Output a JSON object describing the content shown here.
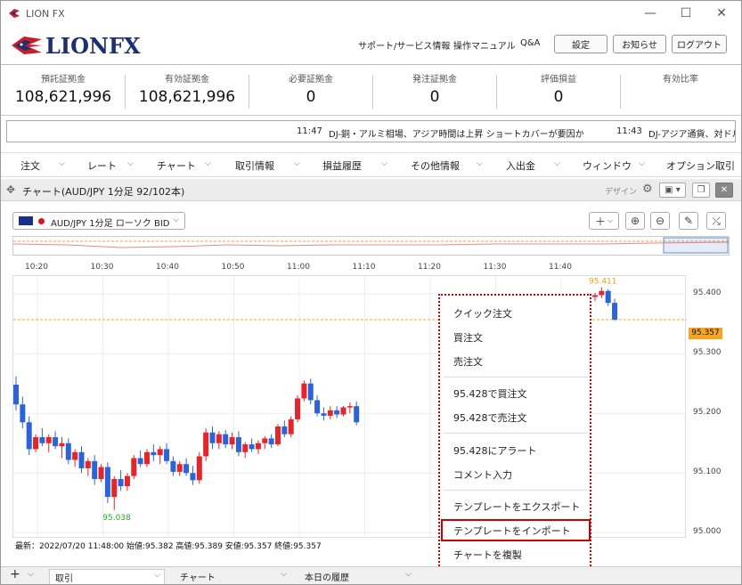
{
  "window": {
    "title": "LION FX",
    "minimize": "—",
    "maximize": "☐",
    "close": "✕"
  },
  "brand": {
    "logo_text": "LIONFX"
  },
  "header_links": [
    "サポート/サービス情報",
    "操作マニュアル",
    "Q&A"
  ],
  "header_buttons": [
    "設定",
    "お知らせ",
    "ログアウト"
  ],
  "summary": [
    {
      "label": "預託証拠金",
      "value": "108,621,996"
    },
    {
      "label": "有効証拠金",
      "value": "108,621,996"
    },
    {
      "label": "必要証拠金",
      "value": "0"
    },
    {
      "label": "発注証拠金",
      "value": "0"
    },
    {
      "label": "評価損益",
      "value": "0"
    },
    {
      "label": "有効比率",
      "value": ""
    }
  ],
  "ticker": [
    {
      "time": "11:47",
      "text": "DJ-銅・アルミ相場、アジア時間は上昇 ショートカバーが要因か"
    },
    {
      "time": "11:43",
      "text": "DJ-アジア通貨、対ドル"
    }
  ],
  "menubar": [
    "注文",
    "レート",
    "チャート",
    "取引情報",
    "損益履歴",
    "その他情報",
    "入出金",
    "ウィンドウ",
    "オプション取引"
  ],
  "chart_window": {
    "title": "チャート(AUD/JPY 1分足 92/102本)",
    "design_label": "デザイン"
  },
  "symbol_select": {
    "value": "AUD/JPY 1分足 ローソク BID"
  },
  "chart_toolbar_icons": [
    "plus-icon",
    "zoom-in-icon",
    "zoom-out-icon",
    "pen-icon",
    "trendline-icon"
  ],
  "chart_data": {
    "type": "candlestick",
    "title": "",
    "x_tick_labels": [
      "10:20",
      "10:30",
      "10:40",
      "10:50",
      "11:00",
      "11:10",
      "11:20",
      "11:30",
      "11:40"
    ],
    "y_tick_labels": [
      "95.400",
      "95.300",
      "95.200",
      "95.100",
      "95.000"
    ],
    "ylim": [
      94.99,
      95.43
    ],
    "current_price": "95.357",
    "high_label": "95.411",
    "low_label": "95.038",
    "candles": [
      [
        95.248,
        95.262,
        95.205,
        95.215
      ],
      [
        95.215,
        95.228,
        95.175,
        95.185
      ],
      [
        95.185,
        95.195,
        95.13,
        95.14
      ],
      [
        95.14,
        95.165,
        95.135,
        95.16
      ],
      [
        95.16,
        95.175,
        95.145,
        95.15
      ],
      [
        95.15,
        95.165,
        95.135,
        95.16
      ],
      [
        95.16,
        95.17,
        95.14,
        95.145
      ],
      [
        95.145,
        95.16,
        95.125,
        95.15
      ],
      [
        95.15,
        95.158,
        95.115,
        95.122
      ],
      [
        95.122,
        95.14,
        95.11,
        95.135
      ],
      [
        95.135,
        95.145,
        95.1,
        95.108
      ],
      [
        95.108,
        95.125,
        95.095,
        95.12
      ],
      [
        95.12,
        95.13,
        95.08,
        95.09
      ],
      [
        95.09,
        95.115,
        95.085,
        95.11
      ],
      [
        95.11,
        95.118,
        95.05,
        95.06
      ],
      [
        95.06,
        95.095,
        95.038,
        95.09
      ],
      [
        95.09,
        95.105,
        95.07,
        95.078
      ],
      [
        95.078,
        95.1,
        95.07,
        95.095
      ],
      [
        95.095,
        95.13,
        95.09,
        95.125
      ],
      [
        95.125,
        95.138,
        95.11,
        95.115
      ],
      [
        95.115,
        95.14,
        95.11,
        95.135
      ],
      [
        95.135,
        95.148,
        95.12,
        95.13
      ],
      [
        95.13,
        95.145,
        95.115,
        95.14
      ],
      [
        95.14,
        95.15,
        95.115,
        95.12
      ],
      [
        95.12,
        95.128,
        95.095,
        95.102
      ],
      [
        95.102,
        95.12,
        95.095,
        95.115
      ],
      [
        95.115,
        95.125,
        95.095,
        95.1
      ],
      [
        95.1,
        95.112,
        95.08,
        95.088
      ],
      [
        95.088,
        95.135,
        95.082,
        95.128
      ],
      [
        95.128,
        95.175,
        95.12,
        95.168
      ],
      [
        95.168,
        95.178,
        95.14,
        95.15
      ],
      [
        95.15,
        95.17,
        95.14,
        95.165
      ],
      [
        95.165,
        95.172,
        95.142,
        95.148
      ],
      [
        95.148,
        95.168,
        95.14,
        95.16
      ],
      [
        95.16,
        95.17,
        95.128,
        95.135
      ],
      [
        95.135,
        95.152,
        95.125,
        95.148
      ],
      [
        95.148,
        95.158,
        95.135,
        95.14
      ],
      [
        95.14,
        95.155,
        95.132,
        95.15
      ],
      [
        95.15,
        95.162,
        95.14,
        95.158
      ],
      [
        95.158,
        95.165,
        95.142,
        95.148
      ],
      [
        95.148,
        95.182,
        95.145,
        95.178
      ],
      [
        95.178,
        95.188,
        95.16,
        95.165
      ],
      [
        95.165,
        95.195,
        95.16,
        95.19
      ],
      [
        95.19,
        95.23,
        95.185,
        95.225
      ],
      [
        95.225,
        95.255,
        95.22,
        95.25
      ],
      [
        95.25,
        95.258,
        95.215,
        95.222
      ],
      [
        95.222,
        95.23,
        95.195,
        95.2
      ],
      [
        95.2,
        95.21,
        95.188,
        95.196
      ],
      [
        95.196,
        95.212,
        95.19,
        95.205
      ],
      [
        95.205,
        95.212,
        95.192,
        95.198
      ],
      [
        95.198,
        95.212,
        95.195,
        95.21
      ],
      [
        95.21,
        95.218,
        95.2,
        95.212
      ],
      [
        95.212,
        95.22,
        95.18,
        95.185
      ]
    ],
    "tail_candles": [
      [
        95.395,
        95.402,
        95.388,
        95.398
      ],
      [
        95.398,
        95.411,
        95.393,
        95.405
      ],
      [
        95.405,
        95.408,
        95.38,
        95.385
      ],
      [
        95.385,
        95.392,
        95.355,
        95.357
      ]
    ]
  },
  "status_line": "最新：2022/07/20 11:48:00 始値:95.382 高値:95.389 安値:95.357 終値:95.357",
  "context_menu": [
    "クイック注文",
    "買注文",
    "売注文",
    "95.428で買注文",
    "95.428で売注文",
    "95.428にアラート",
    "コメント入力",
    "テンプレートをエクスポート",
    "テンプレートをインポート",
    "チャートを複製"
  ],
  "bottom_tabs": [
    "取引",
    "チャート",
    "本日の履歴"
  ],
  "colors": {
    "up": "#e2262b",
    "down": "#2d63d8",
    "accent": "#f5a623",
    "highlight": "#cc0000"
  }
}
